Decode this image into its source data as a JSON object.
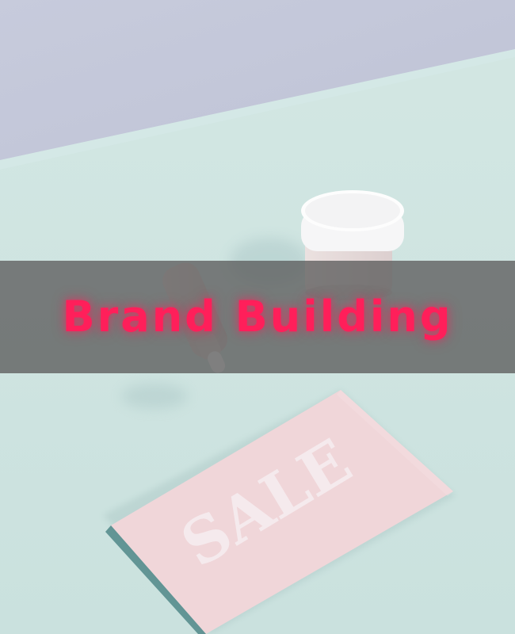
{
  "banner": {
    "title": "Brand Building",
    "title_color": "#ff1f5a",
    "overlay_color": "#5c5c5c"
  },
  "photo": {
    "card_text": "SALE",
    "colors": {
      "wall": "#c4c8da",
      "table": "#cfe4e1",
      "card": "#f1d6d9",
      "jar_lid": "#f7f7f7",
      "jar_body": "#e7dada"
    },
    "objects": [
      "jar-icon",
      "dropper-bottle-icon",
      "sale-card-icon"
    ]
  }
}
